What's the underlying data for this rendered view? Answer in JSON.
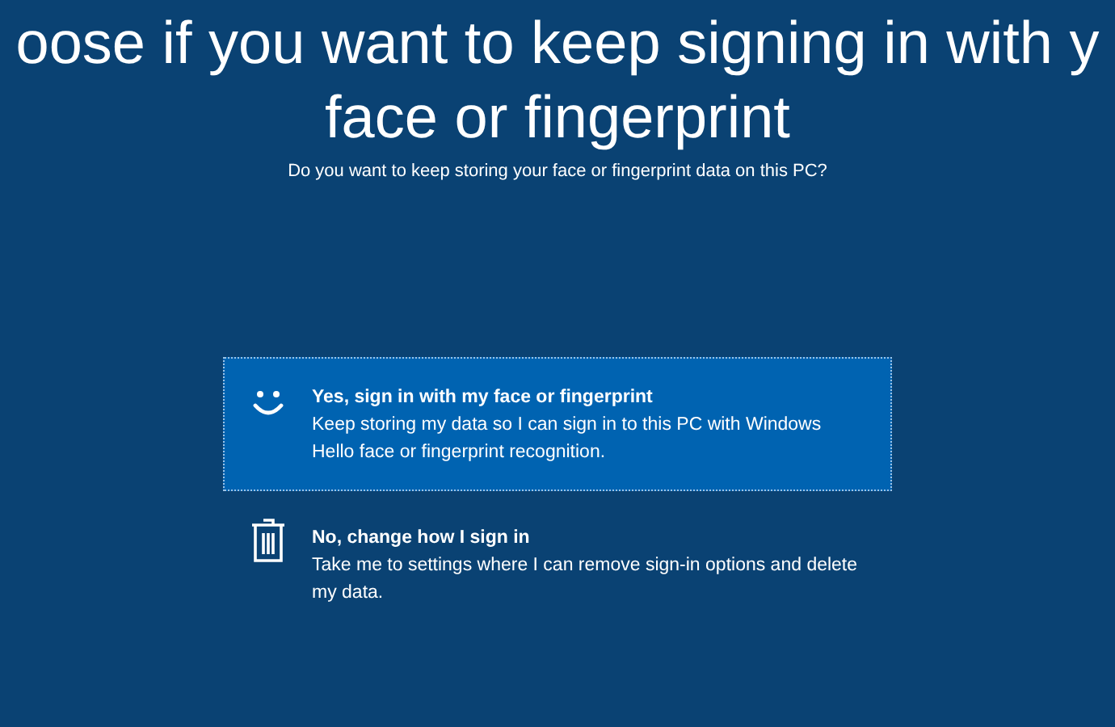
{
  "title_lines": [
    "oose if you want to keep signing in with y",
    "face or fingerprint"
  ],
  "subtitle": "Do you want to keep storing your face or fingerprint data on this PC?",
  "options": [
    {
      "kind": "smile",
      "selected": true,
      "title": "Yes, sign in with my face or fingerprint",
      "description": "Keep storing my data so I can sign in to this PC with Windows Hello face or fingerprint recognition."
    },
    {
      "kind": "trash",
      "selected": false,
      "title": "No, change how I sign in",
      "description": "Take me to settings where I can remove sign-in options and delete my data."
    }
  ]
}
